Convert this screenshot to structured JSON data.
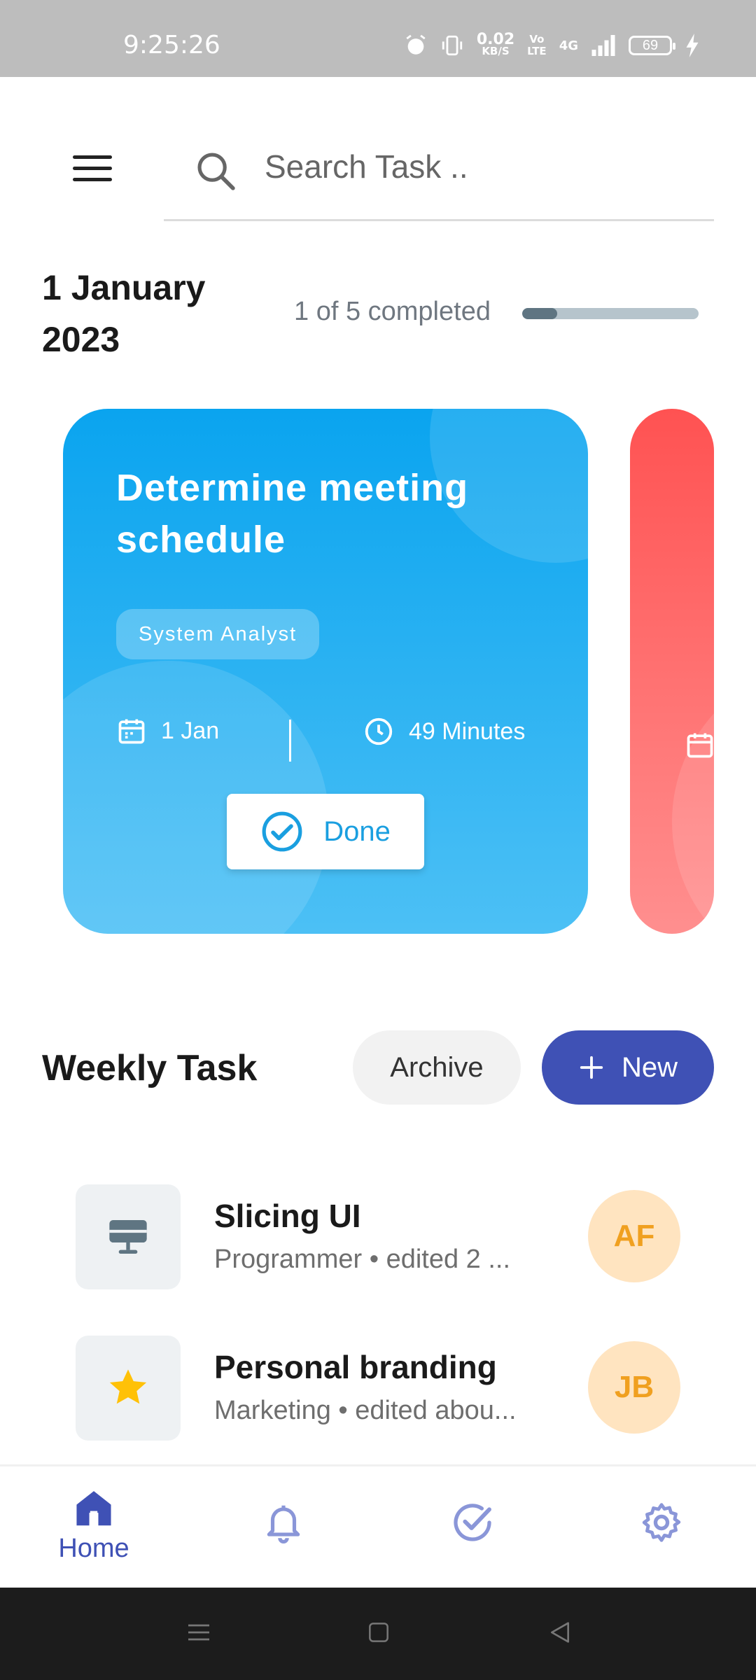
{
  "status_bar": {
    "time": "9:25:26",
    "net_speed_value": "0.02",
    "net_speed_unit": "KB/S",
    "volte_top": "Vo",
    "volte_bottom": "LTE",
    "network": "4G",
    "battery": "69"
  },
  "search": {
    "placeholder": "Search Task .."
  },
  "summary": {
    "date": "1 January 2023",
    "progress_text": "1 of 5 completed",
    "completed": 1,
    "total": 5,
    "progress_color": "#5f7582"
  },
  "cards": [
    {
      "title": "Determine meeting schedule",
      "tag": "System Analyst",
      "date": "1 Jan",
      "duration": "49 Minutes",
      "done_label": "Done",
      "color": "#0aa4ef"
    },
    {
      "color": "#ff5252"
    }
  ],
  "weekly": {
    "title": "Weekly Task",
    "archive_label": "Archive",
    "new_label": "New",
    "new_button_color": "#3f51b5",
    "tasks": [
      {
        "title": "Slicing UI",
        "subtitle": "Programmer • edited 2 ...",
        "icon": "monitor-icon",
        "avatar": "AF"
      },
      {
        "title": "Personal branding",
        "subtitle": "Marketing • edited abou...",
        "icon": "star-icon",
        "avatar": "JB"
      }
    ]
  },
  "bottom_nav": {
    "items": [
      {
        "label": "Home",
        "icon": "home-icon",
        "active": true
      },
      {
        "icon": "bell-icon"
      },
      {
        "icon": "check-circle-icon"
      },
      {
        "icon": "gear-icon"
      }
    ]
  },
  "system_nav": {
    "items": [
      "menu-icon",
      "square-icon",
      "back-icon"
    ]
  }
}
